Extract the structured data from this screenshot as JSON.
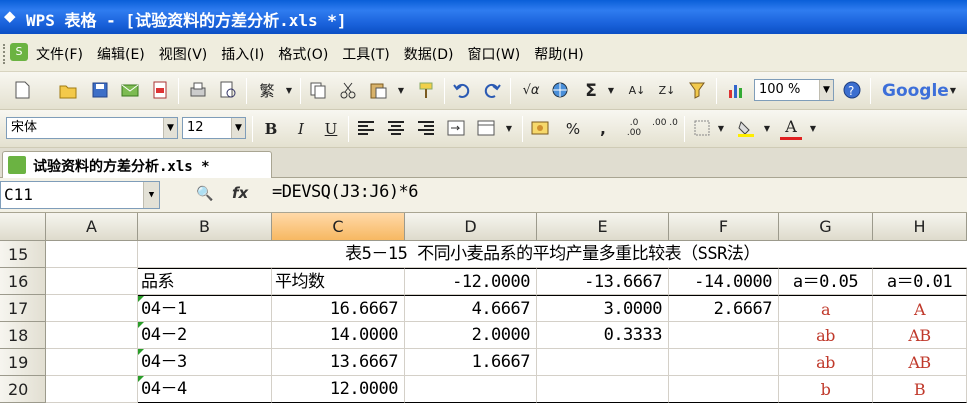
{
  "window": {
    "title": "WPS 表格 - [试验资料的方差分析.xls *]"
  },
  "menu": [
    "文件(F)",
    "编辑(E)",
    "视图(V)",
    "插入(I)",
    "格式(O)",
    "工具(T)",
    "数据(D)",
    "窗口(W)",
    "帮助(H)"
  ],
  "toolbar": {
    "zoom": "100 %",
    "google": "Google",
    "trad_char": "繁",
    "sigma": "Σ"
  },
  "format_toolbar": {
    "font": "宋体",
    "size": "12",
    "bold": "B",
    "italic": "I",
    "underline": "U",
    "percent": "%",
    "comma": ",",
    "inc_dec": ".0 .00",
    "dec_dec": ".00 .0",
    "font_color": "A"
  },
  "tab": {
    "label": "试验资料的方差分析.xls *"
  },
  "formula_bar": {
    "cell_ref": "C11",
    "fx": "fx",
    "formula": "=DEVSQ(J3:J6)*6"
  },
  "columns": [
    "A",
    "B",
    "C",
    "D",
    "E",
    "F",
    "G",
    "H"
  ],
  "rows": {
    "r15": {
      "num": "15",
      "title": "表5－15  不同小麦品系的平均产量多重比较表（SSR法）"
    },
    "r16": {
      "num": "16",
      "b": "品系",
      "c": "平均数",
      "d": "-12.0000",
      "e": "-13.6667",
      "f": "-14.0000",
      "g": "a＝0.05",
      "h": "a＝0.01"
    },
    "r17": {
      "num": "17",
      "b": "04－1",
      "c": "16.6667",
      "d": "4.6667",
      "e": "3.0000",
      "f": "2.6667",
      "g": "a",
      "h": "A"
    },
    "r18": {
      "num": "18",
      "b": "04－2",
      "c": "14.0000",
      "d": "2.0000",
      "e": "0.3333",
      "f": "",
      "g": "ab",
      "h": "AB"
    },
    "r19": {
      "num": "19",
      "b": "04－3",
      "c": "13.6667",
      "d": "1.6667",
      "e": "",
      "f": "",
      "g": "ab",
      "h": "AB"
    },
    "r20": {
      "num": "20",
      "b": "04－4",
      "c": "12.0000",
      "d": "",
      "e": "",
      "f": "",
      "g": "b",
      "h": "B"
    }
  }
}
